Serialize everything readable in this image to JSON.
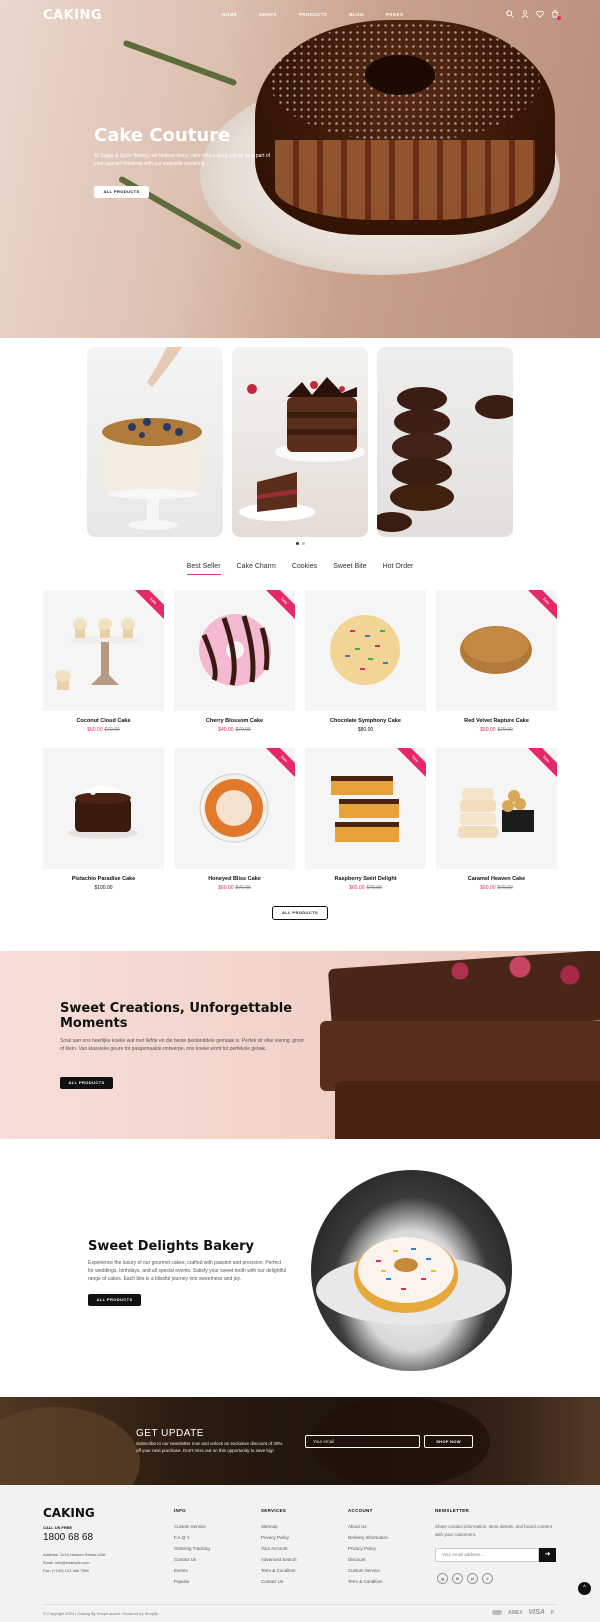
{
  "brand": {
    "logo": "CAKING"
  },
  "nav": {
    "items": [
      "HOME",
      "SHOPS",
      "PRODUCTS",
      "BLOG",
      "PAGES"
    ],
    "icons": [
      "search-icon",
      "user-icon",
      "heart-icon",
      "cart-icon"
    ]
  },
  "hero": {
    "title": "Cake Couture",
    "text": "At Sugar & Spice Bakery, we believe every cake tells a story. Let us be a part of your special moments with our exquisite creations.",
    "button": "ALL PRODUCTS"
  },
  "tabs": [
    "Best Seller",
    "Cake Charm",
    "Cookies",
    "Sweet Bite",
    "Hot Order"
  ],
  "products": [
    {
      "name": "Coconut Cloud Cake",
      "price": "$60.00",
      "old": "$70.00",
      "sale": true
    },
    {
      "name": "Cherry Blossom Cake",
      "price": "$40.00",
      "old": "$70.00",
      "sale": true
    },
    {
      "name": "Chocolate Symphony Cake",
      "price": "$80.00",
      "old": "",
      "sale": false
    },
    {
      "name": "Red Velvet Rapture Cake",
      "price": "$60.00",
      "old": "$70.00",
      "sale": true
    },
    {
      "name": "Pistachio Paradise Cake",
      "price": "$100.00",
      "old": "",
      "sale": false
    },
    {
      "name": "Honeyed Bliss Cake",
      "price": "$60.00",
      "old": "$70.00",
      "sale": true
    },
    {
      "name": "Raspberry Swirl Delight",
      "price": "$60.00",
      "old": "$70.00",
      "sale": true
    },
    {
      "name": "Caramel Heaven Cake",
      "price": "$60.00",
      "old": "$70.00",
      "sale": true
    }
  ],
  "sale_label": "Sale",
  "all_products_button": "ALL PRODUCTS",
  "banner1": {
    "title": "Sweet Creations, Unforgettable Moments",
    "text": "Smul aan ons heerlijke koeke wat met liefde en die beste bestanddele gemaak is. Perfek vir elke viering, groot of klein. Van klassieke geure tot pasgemaakte ontwerpe, ons koeke word tot perfeksie gebak.",
    "button": "ALL PRODUCTS"
  },
  "banner2": {
    "title": "Sweet Delights Bakery",
    "text": "Experience the luxury of our gourmet cakes, crafted with passion and precision. Perfect for weddings, birthdays, and all special events. Satisfy your sweet tooth with our delightful range of cakes. Each bite is a blissful journey into sweetness and joy.",
    "button": "ALL PRODUCTS"
  },
  "getupdate": {
    "title": "GET UPDATE",
    "text": "Subscribe to our newsletter now and unlock an exclusive discount of 30% off your next purchase. Don't miss out on this opportunity to save big!",
    "placeholder": "Your email",
    "button": "SHOP NOW"
  },
  "footer": {
    "logo": "CAKING",
    "call_label": "CALL US FREE",
    "phone": "1800 68 68",
    "address": "Address: 1234 Heaven Stress,USA",
    "email": "Email: info@example.com",
    "fax": "Fax: (+100) 123 456 7890",
    "info": {
      "title": "INFO",
      "links": [
        "Custom Service",
        "F.A.Q.'s",
        "Ordering Tracking",
        "Contact Us",
        "Events",
        "Popular"
      ]
    },
    "services": {
      "title": "SERVICES",
      "links": [
        "Sitemap",
        "Privacy Policy",
        "Your Account",
        "Advanced Search",
        "Term & Condition",
        "Contact Us"
      ]
    },
    "account": {
      "title": "ACCOUNT",
      "links": [
        "About Us",
        "Delivery Information",
        "Privacy Policy",
        "Discount",
        "Custom Service",
        "Term & Condition"
      ]
    },
    "newsletter": {
      "title": "NEWSLETTER",
      "text": "Share contact information, store details, and brand content with your customers.",
      "placeholder": "Your email address..."
    },
    "social": [
      "ig",
      "fb",
      "pi",
      "x"
    ],
    "copyright": "© Copyright 2024 | Caking By ShopiLaunch. Powered by Shopify.",
    "payments": [
      "AMEX",
      "VISA",
      "P"
    ]
  }
}
